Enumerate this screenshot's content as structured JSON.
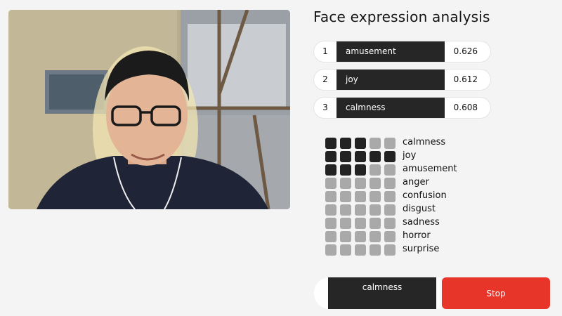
{
  "title": "Face expression analysis",
  "video": {
    "icon": "webcam-feed"
  },
  "top_expressions": [
    {
      "rank": "1",
      "label": "amusement",
      "score": "0.626"
    },
    {
      "rank": "2",
      "label": "joy",
      "score": "0.612"
    },
    {
      "rank": "3",
      "label": "calmness",
      "score": "0.608"
    }
  ],
  "expression_grid": [
    {
      "label": "calmness",
      "level": 3
    },
    {
      "label": "joy",
      "level": 5
    },
    {
      "label": "amusement",
      "level": 3
    },
    {
      "label": "anger",
      "level": 0
    },
    {
      "label": "confusion",
      "level": 0
    },
    {
      "label": "disgust",
      "level": 0
    },
    {
      "label": "sadness",
      "level": 0
    },
    {
      "label": "horror",
      "level": 0
    },
    {
      "label": "surprise",
      "level": 0
    }
  ],
  "grid_max_level": 5,
  "current_label": "calmness",
  "stop_label": "Stop",
  "colors": {
    "accent": "#e8352a",
    "bar": "#262626",
    "cell_on": "#222222",
    "cell_off": "#a9a9a9"
  }
}
